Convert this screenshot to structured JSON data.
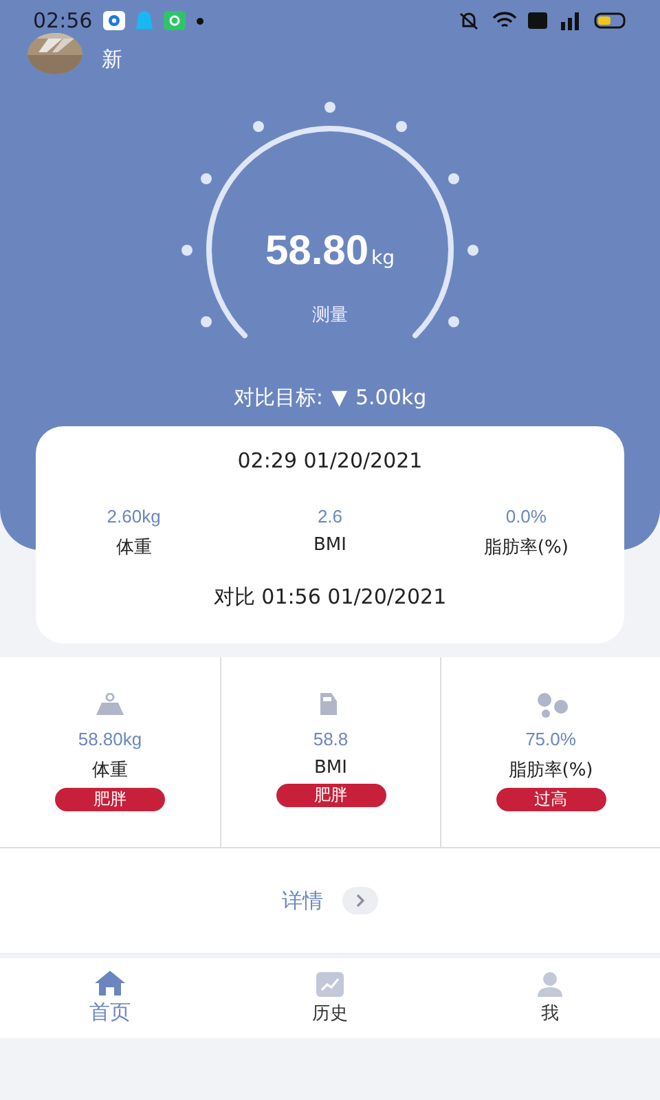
{
  "status_bar": {
    "time": "02:56"
  },
  "header": {
    "title": "新"
  },
  "gauge": {
    "value": "58.80",
    "unit": "kg",
    "caption": "测量",
    "target_label": "对比目标:",
    "target_arrow": "▼",
    "target_value": "5.00kg"
  },
  "record": {
    "time": "02:29 01/20/2021",
    "stats": [
      {
        "value": "2.60kg",
        "label": "体重"
      },
      {
        "value": "2.6",
        "label": "BMI"
      },
      {
        "value": "0.0%",
        "label": "脂肪率(%)"
      }
    ],
    "compare": "对比 01:56 01/20/2021"
  },
  "metrics": [
    {
      "kind": "weight",
      "value": "58.80kg",
      "label": "体重",
      "tag": "肥胖"
    },
    {
      "kind": "bmi",
      "value": "58.8",
      "label": "BMI",
      "tag": "肥胖"
    },
    {
      "kind": "fat",
      "value": "75.0%",
      "label": "脂肪率(%)",
      "tag": "过高"
    }
  ],
  "details": {
    "label": "详情"
  },
  "tabs": [
    {
      "kind": "home",
      "label": "首页",
      "selected": true
    },
    {
      "kind": "history",
      "label": "历史",
      "selected": false
    },
    {
      "kind": "me",
      "label": "我",
      "selected": false
    }
  ]
}
